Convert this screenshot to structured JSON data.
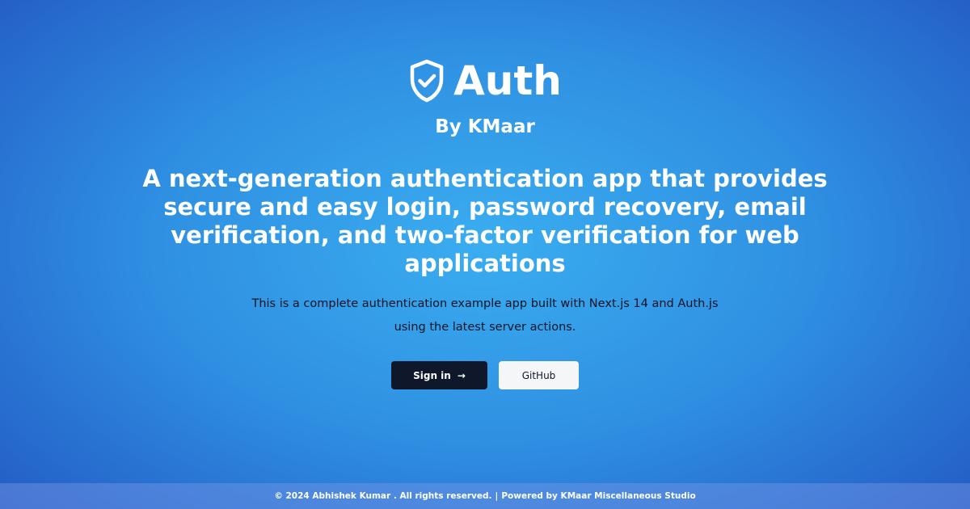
{
  "brand": {
    "title": "Auth",
    "icon": "shield-check-icon",
    "byline": "By KMaar"
  },
  "hero": {
    "headline": "A next-generation authentication app that provides secure and easy login, password recovery, email verification, and two-factor verification for web applications",
    "description": "This is a complete authentication example app built with Next.js 14 and Auth.js using the latest server actions."
  },
  "actions": {
    "signin_label": "Sign in",
    "signin_icon": "arrow-right-icon",
    "github_label": "GitHub"
  },
  "footer": {
    "copyright": "© 2024 Abhishek Kumar . All rights reserved.",
    "separator": "|",
    "powered_by": "Powered by KMaar Miscellaneous Studio"
  },
  "colors": {
    "background_center": "#3aadf0",
    "background_edge": "#2350bc",
    "primary_button": "#0f172a",
    "secondary_button": "#f4f6f8",
    "text": "#ffffff",
    "description_text": "#0c1424"
  }
}
